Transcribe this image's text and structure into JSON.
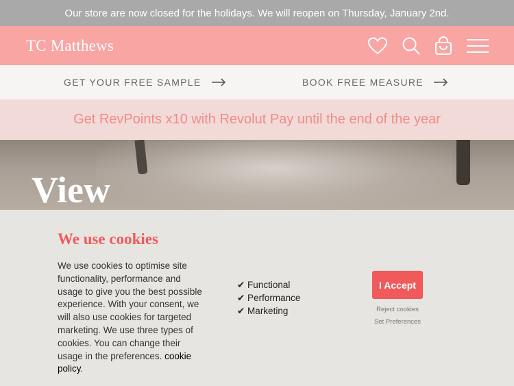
{
  "announcement": {
    "text": "Our store are now closed for the holidays. We will reopen on Thursday, January 2nd."
  },
  "header": {
    "logo": "TC Matthews",
    "icons": [
      "heart-icon",
      "search-icon",
      "cart-icon",
      "menu-icon"
    ]
  },
  "cta_bar": {
    "sample_label": "GET YOUR FREE SAMPLE",
    "measure_label": "BOOK FREE MEASURE"
  },
  "promo": {
    "text": "Get RevPoints x10 with Revolut Pay until the end of the year"
  },
  "hero": {
    "title": "View"
  },
  "cookie_banner": {
    "title": "We use cookies",
    "body": "We use cookies to optimise site functionality, performance and usage to give you the best possible experience. With your consent, we will also use cookies for targeted marketing. We use three types of cookies. You can change their usage in the preferences.",
    "policy_link": "cookie policy",
    "policy_suffix": ".",
    "types": [
      "✔ Functional",
      "✔ Performance",
      "✔ Marketing"
    ],
    "accept_label": "I Accept",
    "reject_label": "Reject cookies",
    "preferences_label": "Set Preferences"
  },
  "colors": {
    "announcement_bg": "#a9a9a9",
    "header_bg": "#f8a5a3",
    "promo_bg": "#f2dad8",
    "promo_text": "#f08c88",
    "accent": "#f05a5a",
    "cookie_bg": "#e7e5e1"
  }
}
